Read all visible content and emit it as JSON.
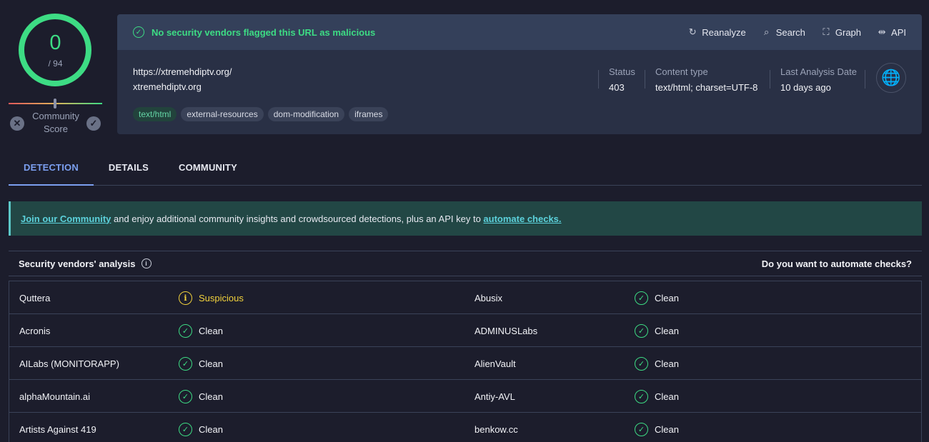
{
  "score": {
    "detections": "0",
    "total": "/ 94",
    "community_label": "Community Score",
    "vote_down_icon": "x-circle-icon",
    "vote_up_icon": "check-circle-icon"
  },
  "banner": {
    "text": "No security vendors flagged this URL as malicious",
    "icon": "check-circle-icon",
    "status_color": "#3ddc84"
  },
  "actions": [
    {
      "label": "Reanalyze",
      "icon": "refresh-icon"
    },
    {
      "label": "Search",
      "icon": "search-icon"
    },
    {
      "label": "Graph",
      "icon": "graph-icon"
    },
    {
      "label": "API",
      "icon": "api-icon"
    }
  ],
  "target": {
    "url": "https://xtremehdiptv.org/",
    "host": "xtremehdiptv.org"
  },
  "tags": [
    "text/html",
    "external-resources",
    "dom-modification",
    "iframes"
  ],
  "meta": {
    "status_label": "Status",
    "status_value": "403",
    "content_type_label": "Content type",
    "content_type_value": "text/html; charset=UTF-8",
    "last_analysis_label": "Last Analysis Date",
    "last_analysis_value": "10 days ago"
  },
  "tabs": [
    "DETECTION",
    "DETAILS",
    "COMMUNITY"
  ],
  "active_tab": "DETECTION",
  "notice": {
    "link1": "Join our Community",
    "middle": " and enjoy additional community insights and crowdsourced detections, plus an API key to ",
    "link2": "automate checks."
  },
  "vendors": {
    "title": "Security vendors' analysis",
    "automate_prompt": "Do you want to automate checks?",
    "rows": [
      {
        "left_vendor": "Quttera",
        "left_result": "Suspicious",
        "right_vendor": "Abusix",
        "right_result": "Clean"
      },
      {
        "left_vendor": "Acronis",
        "left_result": "Clean",
        "right_vendor": "ADMINUSLabs",
        "right_result": "Clean"
      },
      {
        "left_vendor": "AILabs (MONITORAPP)",
        "left_result": "Clean",
        "right_vendor": "AlienVault",
        "right_result": "Clean"
      },
      {
        "left_vendor": "alphaMountain.ai",
        "left_result": "Clean",
        "right_vendor": "Antiy-AVL",
        "right_result": "Clean"
      },
      {
        "left_vendor": "Artists Against 419",
        "left_result": "Clean",
        "right_vendor": "benkow.cc",
        "right_result": "Clean"
      }
    ]
  },
  "colors": {
    "clean": "#3ddc84",
    "suspicious": "#f2d23c",
    "accent_tab": "#7b9ff0",
    "notice_link": "#5cd2dc"
  }
}
